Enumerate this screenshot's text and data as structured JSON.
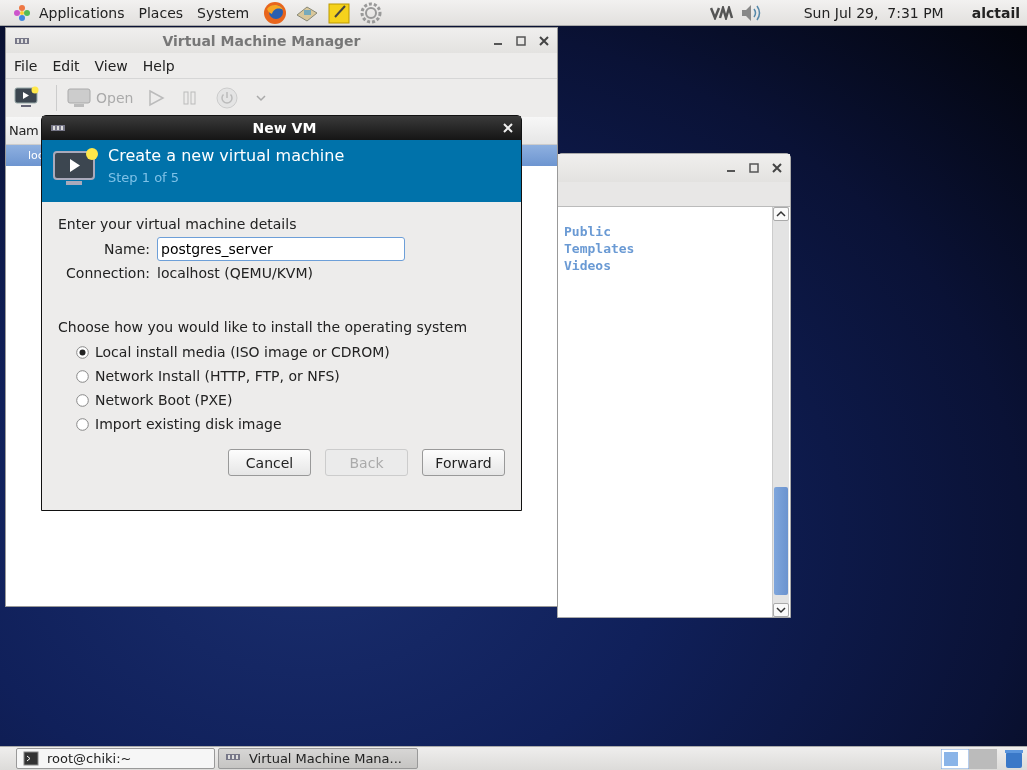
{
  "top_panel": {
    "menus": [
      "Applications",
      "Places",
      "System"
    ],
    "clock": "Sun Jul 29,  7:31 PM",
    "user": "alctail"
  },
  "manager_window": {
    "title": "Virtual Machine Manager",
    "menu": [
      "File",
      "Edit",
      "View",
      "Help"
    ],
    "open_label": "Open",
    "list_header": "Nam",
    "rows": [
      {
        "label": "loc",
        "selected": true
      }
    ]
  },
  "file_window": {
    "items": [
      "Public",
      "Templates",
      "Videos"
    ]
  },
  "dialog": {
    "title": "New VM",
    "heading": "Create a new virtual machine",
    "step": "Step 1 of 5",
    "details_label": "Enter your virtual machine details",
    "name_label": "Name:",
    "name_value": "postgres_server",
    "connection_label": "Connection:",
    "connection_value": "localhost (QEMU/KVM)",
    "install_label": "Choose how you would like to install the operating system",
    "options": [
      {
        "label": "Local install media (ISO image or CDROM)",
        "selected": true
      },
      {
        "label": "Network Install (HTTP, FTP, or NFS)",
        "selected": false
      },
      {
        "label": "Network Boot (PXE)",
        "selected": false
      },
      {
        "label": "Import existing disk image",
        "selected": false
      }
    ],
    "buttons": [
      {
        "label": "Cancel",
        "disabled": false
      },
      {
        "label": "Back",
        "disabled": true
      },
      {
        "label": "Forward",
        "disabled": false
      }
    ]
  },
  "taskbar": [
    {
      "label": "root@chiki:~",
      "kind": "terminal"
    },
    {
      "label": "Virtual Machine Mana...",
      "kind": "vmm"
    }
  ]
}
